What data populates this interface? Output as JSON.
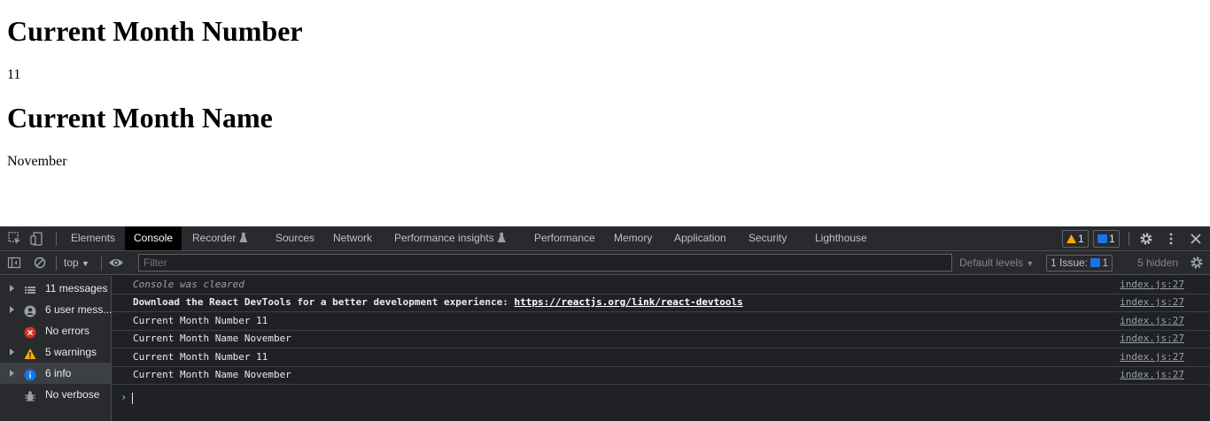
{
  "page": {
    "heading_number": "Current Month Number",
    "month_number": "11",
    "heading_name": "Current Month Name",
    "month_name": "November"
  },
  "devtools": {
    "tabs": [
      "Elements",
      "Console",
      "Recorder",
      "Sources",
      "Network",
      "Performance insights",
      "Performance",
      "Memory",
      "Application",
      "Security",
      "Lighthouse"
    ],
    "active_tab": "Console",
    "warning_badge": "1",
    "message_badge": "1",
    "toolbar": {
      "context": "top",
      "filter_placeholder": "Filter",
      "levels": "Default levels",
      "issues_label": "1 Issue:",
      "issues_count": "1",
      "hidden": "5 hidden"
    },
    "sidebar": [
      {
        "label": "11 messages",
        "icon": "list-icon"
      },
      {
        "label": "6 user mess...",
        "icon": "user-icon"
      },
      {
        "label": "No errors",
        "icon": "error-icon"
      },
      {
        "label": "5 warnings",
        "icon": "warning-icon"
      },
      {
        "label": "6 info",
        "icon": "info-icon"
      },
      {
        "label": "No verbose",
        "icon": "bug-icon"
      }
    ],
    "messages": [
      {
        "text": "Console was cleared",
        "source": "index.js:27"
      },
      {
        "text": "Download the React DevTools for a better development experience: ",
        "link": "https://reactjs.org/link/react-devtools",
        "source": "index.js:27"
      },
      {
        "text": "Current Month Number 11",
        "source": "index.js:27"
      },
      {
        "text": "Current Month Name November",
        "source": "index.js:27"
      },
      {
        "text": "Current Month Number 11",
        "source": "index.js:27"
      },
      {
        "text": "Current Month Name November",
        "source": "index.js:27"
      }
    ],
    "colors": {
      "background": "#202124",
      "toolbar": "#292a2d",
      "warning": "#f9ab00",
      "info": "#1a73e8",
      "error": "#d93025"
    }
  }
}
